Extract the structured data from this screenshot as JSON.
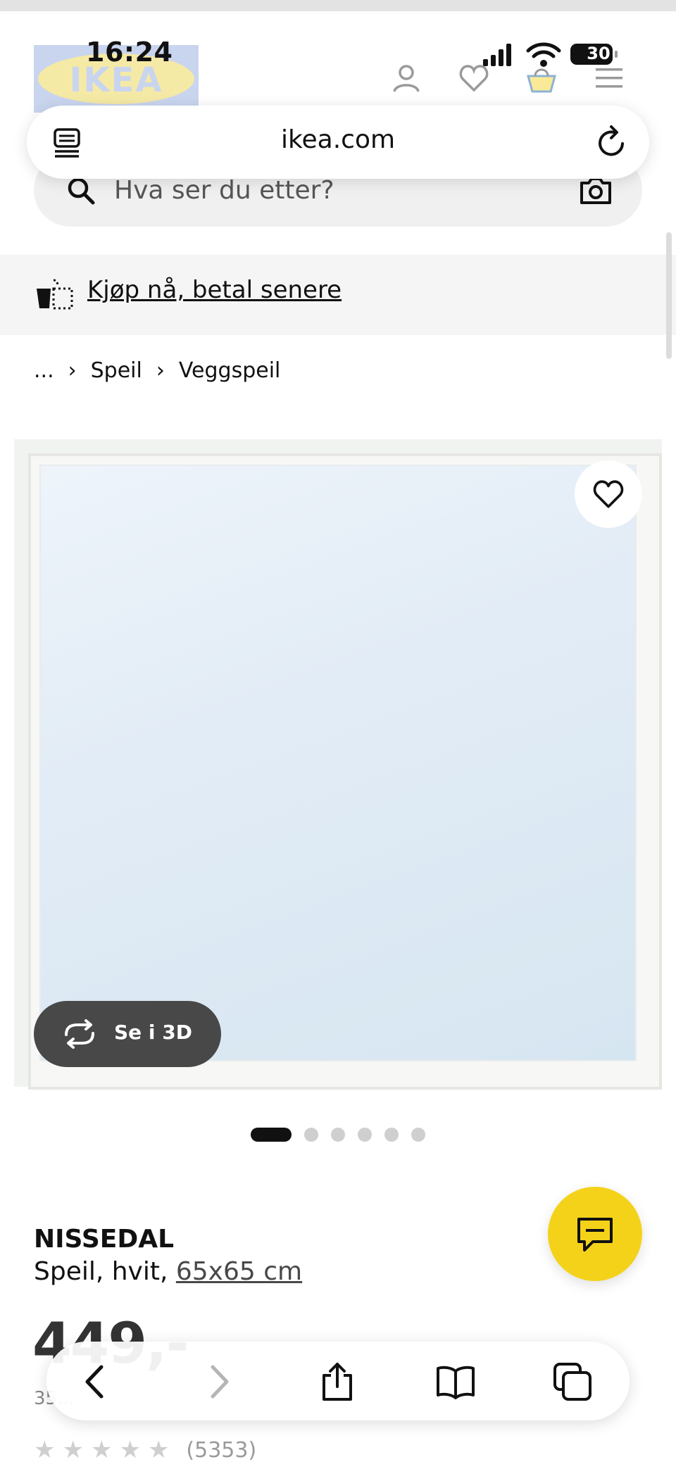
{
  "status_bar": {
    "time": "16:24",
    "battery": "30"
  },
  "header": {
    "logo_text": "IKEA"
  },
  "browser": {
    "url": "ikea.com"
  },
  "search": {
    "placeholder": "Hva ser du etter?"
  },
  "promo": {
    "label": "Kjøp nå, betal senere"
  },
  "breadcrumb": {
    "items": [
      "...",
      "Speil",
      "Veggspeil"
    ]
  },
  "product": {
    "view_3d_label": "Se i 3D",
    "carousel": {
      "total": 6,
      "active": 1
    },
    "name": "NISSEDAL",
    "description": "Speil, hvit, ",
    "size": "65x65 cm",
    "price": "449,-",
    "price_sub": "35...",
    "rating": {
      "stars": 5,
      "count": "(5353)"
    }
  },
  "colors": {
    "ikea_yellow": "#f4d21a",
    "ikea_blue": "#0058a3",
    "dark_button": "#484848"
  }
}
